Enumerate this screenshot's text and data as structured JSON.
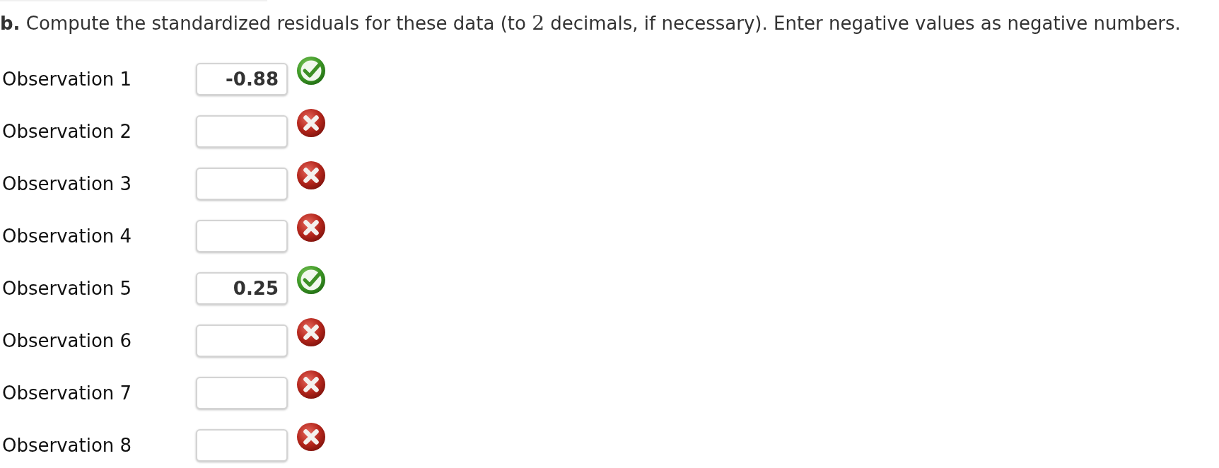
{
  "instruction": [
    {
      "kind": "text",
      "text": "**b.** Compute the standardized residuals for these data (to "
    },
    {
      "kind": "math",
      "text": "2"
    },
    {
      "kind": "text",
      "text": " decimals, if necessary). Enter negative values as negative numbers."
    }
  ],
  "rows": [
    {
      "label": "Observation 1",
      "value": "-0.88",
      "correct": true
    },
    {
      "label": "Observation 2",
      "correct": false
    },
    {
      "label": "Observation 3",
      "correct": false
    },
    {
      "label": "Observation 4",
      "correct": false
    },
    {
      "label": "Observation 5",
      "value": "0.25",
      "correct": true
    },
    {
      "label": "Observation 6",
      "correct": false
    },
    {
      "label": "Observation 7",
      "correct": false
    },
    {
      "label": "Observation 8",
      "correct": false
    }
  ]
}
